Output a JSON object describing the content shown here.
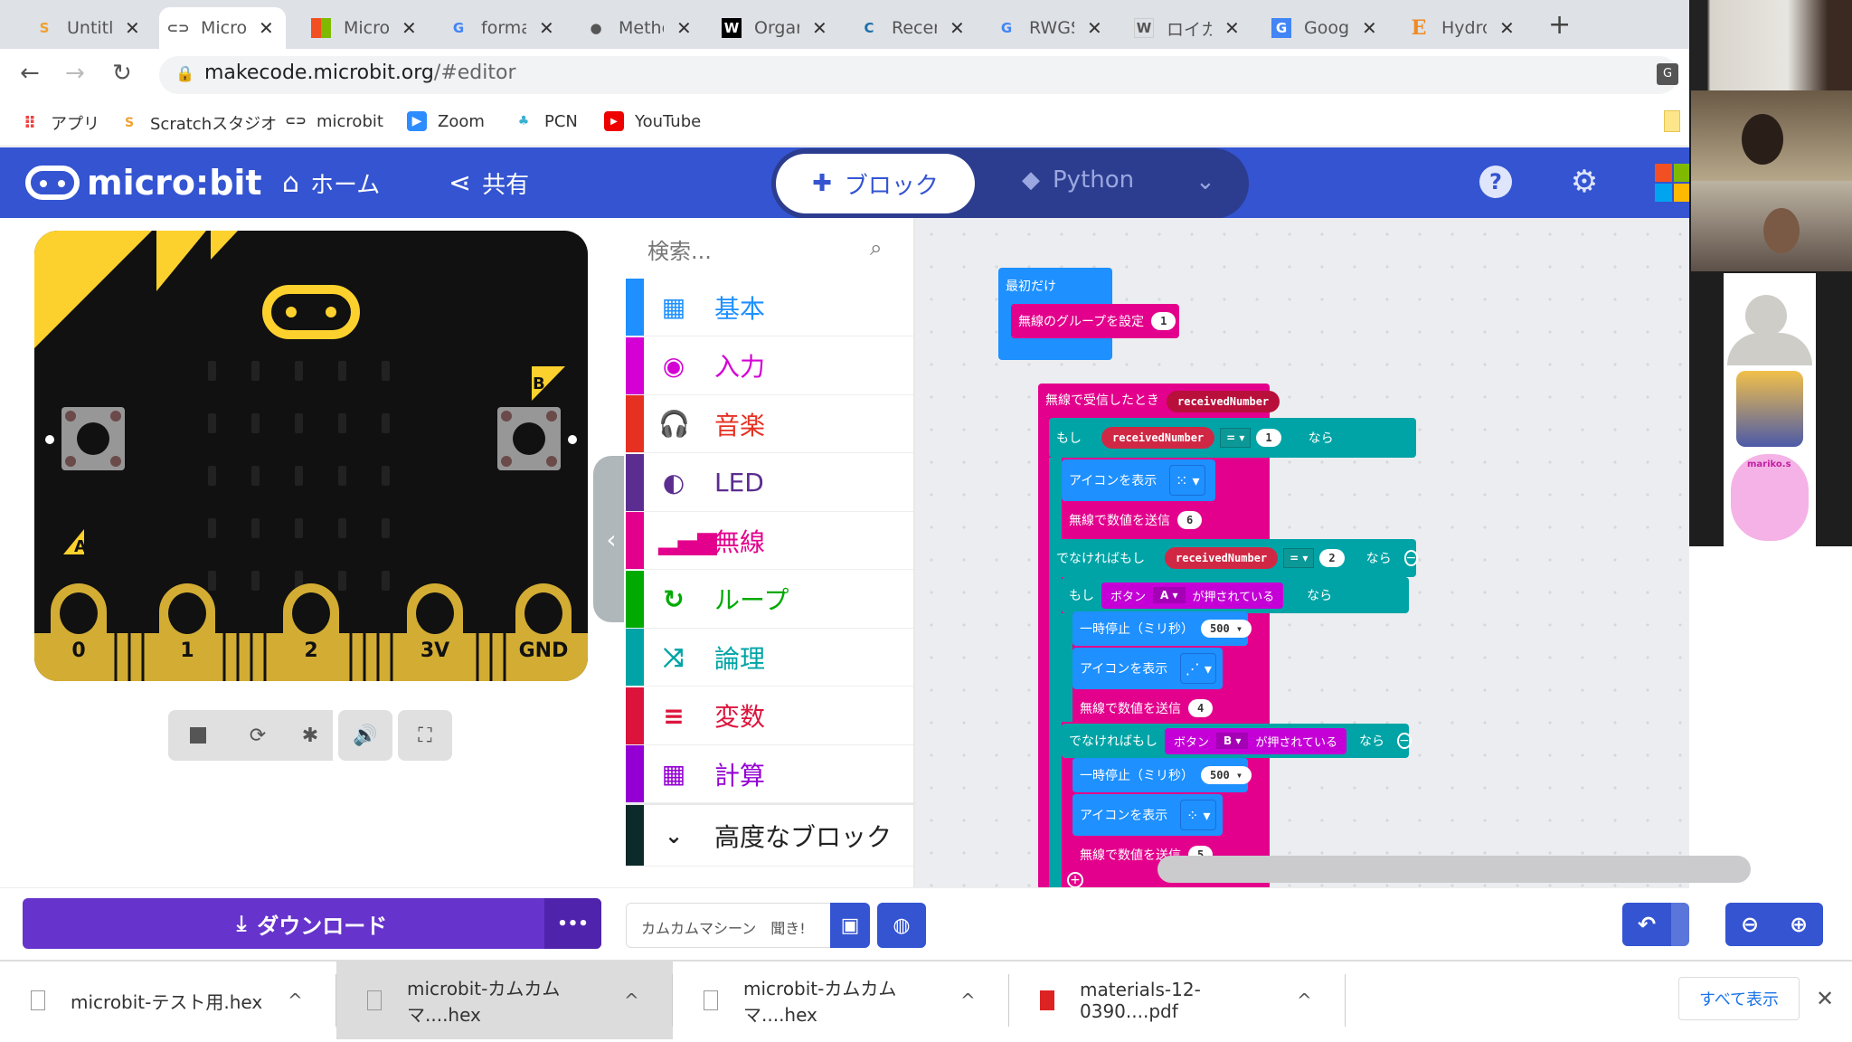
{
  "browser": {
    "tabs": [
      {
        "title": "Untitled",
        "icon": "scratch-icon",
        "active": false
      },
      {
        "title": "Microbit",
        "icon": "microbit-icon",
        "active": true
      },
      {
        "title": "Microsoft",
        "icon": "microsoft-icon",
        "active": false
      },
      {
        "title": "format",
        "icon": "google-icon",
        "active": false
      },
      {
        "title": "Methods",
        "icon": "globe-icon",
        "active": false
      },
      {
        "title": "Organic",
        "icon": "w-icon",
        "active": false
      },
      {
        "title": "Recent",
        "icon": "c-icon",
        "active": false
      },
      {
        "title": "RWGS",
        "icon": "google-icon",
        "active": false
      },
      {
        "title": "ロイカー",
        "icon": "wiki-icon",
        "active": false
      },
      {
        "title": "Google",
        "icon": "translate-icon",
        "active": false
      },
      {
        "title": "Hydro",
        "icon": "e-icon",
        "active": false
      }
    ],
    "new_tab": "+",
    "url_host": "makecode.microbit.org",
    "url_path": "/#editor",
    "bookmarks": [
      {
        "label": "アプリ",
        "icon": "apps-grid-icon"
      },
      {
        "label": "Scratchスタジオ",
        "icon": "scratch-icon"
      },
      {
        "label": "microbit",
        "icon": "microbit-icon"
      },
      {
        "label": "Zoom",
        "icon": "zoom-icon"
      },
      {
        "label": "PCN",
        "icon": "pcn-icon"
      },
      {
        "label": "YouTube",
        "icon": "youtube-icon"
      }
    ]
  },
  "header": {
    "logo_text": "micro:bit",
    "home_label": "ホーム",
    "share_label": "共有",
    "blocks_label": "ブロック",
    "python_label": "Python",
    "help_icon": "?",
    "settings_icon": "⚙"
  },
  "simulator": {
    "pins": [
      "0",
      "1",
      "2",
      "3V",
      "GND"
    ],
    "button_a": "A",
    "button_b": "B",
    "controls": [
      "stop-icon",
      "restart-icon",
      "debug-icon",
      "sound-icon",
      "fullscreen-icon"
    ]
  },
  "toolbox": {
    "search_placeholder": "検索...",
    "categories": [
      {
        "label": "基本",
        "color": "#1e90ff",
        "icon": "▦"
      },
      {
        "label": "入力",
        "color": "#d400d4",
        "icon": "◉"
      },
      {
        "label": "音楽",
        "color": "#e63022",
        "icon": "🎧"
      },
      {
        "label": "LED",
        "color": "#5c2d91",
        "icon": "◐"
      },
      {
        "label": "無線",
        "color": "#e3008c",
        "icon": "▂▄▆"
      },
      {
        "label": "ループ",
        "color": "#00aa00",
        "icon": "↻"
      },
      {
        "label": "論理",
        "color": "#00a4a6",
        "icon": "⤨"
      },
      {
        "label": "変数",
        "color": "#dc143c",
        "icon": "≡"
      },
      {
        "label": "計算",
        "color": "#9400d3",
        "icon": "▦"
      }
    ],
    "advanced_label": "高度なブロック"
  },
  "workspace": {
    "on_start": {
      "label": "最初だけ",
      "set_group": "無線のグループを設定",
      "group_value": "1"
    },
    "on_received": {
      "label": "無線で受信したとき",
      "param": "receivedNumber"
    },
    "if_label": "もし",
    "then_label": "なら",
    "elseif_label": "でなければもし",
    "var_name": "receivedNumber",
    "eq": "= ▾",
    "cond1_value": "1",
    "cond2_value": "2",
    "show_icon": "アイコンを表示",
    "send_number": "無線で数値を送信",
    "send1": "6",
    "send2": "4",
    "send3": "5",
    "pause": "一時停止（ミリ秒）",
    "pause_value": "500 ▾",
    "button_label": "ボタン",
    "button_a": "A ▾",
    "button_b": "B ▾",
    "pressed": "が押されている"
  },
  "bottom": {
    "download_label": "ダウンロード",
    "more_label": "•••",
    "project_name": "カムカムマシーン　聞き!"
  },
  "downloads": {
    "items": [
      {
        "name": "microbit-テスト用.hex",
        "icon": "file-icon"
      },
      {
        "name": "microbit-カムカムマ....hex",
        "icon": "file-icon"
      },
      {
        "name": "microbit-カムカムマ....hex",
        "icon": "file-icon"
      },
      {
        "name": "materials-12-0390....pdf",
        "icon": "pdf-icon"
      }
    ],
    "show_all": "すべて表示",
    "close": "✕"
  },
  "video": {
    "participant_label": "mariko.s"
  }
}
